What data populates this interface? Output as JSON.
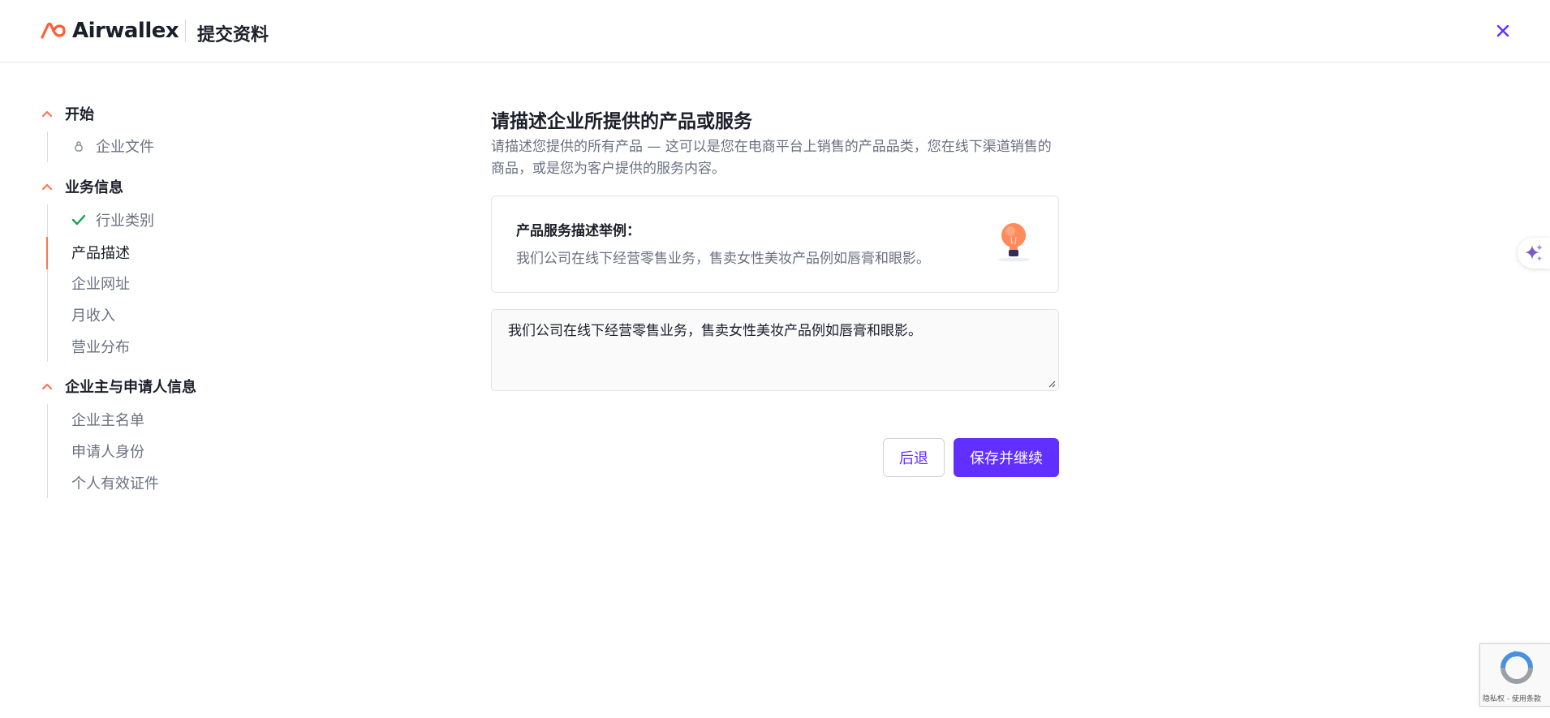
{
  "header": {
    "brand": "Airwallex",
    "title": "提交资料",
    "brand_color": "#ff5f33"
  },
  "sidebar": {
    "sections": [
      {
        "label": "开始",
        "items": [
          {
            "label": "企业文件",
            "icon": "lock-icon"
          }
        ]
      },
      {
        "label": "业务信息",
        "items": [
          {
            "label": "行业类别",
            "icon": "check-icon",
            "status": "completed"
          },
          {
            "label": "产品描述",
            "status": "active"
          },
          {
            "label": "企业网址"
          },
          {
            "label": "月收入"
          },
          {
            "label": "营业分布"
          }
        ]
      },
      {
        "label": "企业主与申请人信息",
        "items": [
          {
            "label": "企业主名单"
          },
          {
            "label": "申请人身份"
          },
          {
            "label": "个人有效证件"
          }
        ]
      }
    ]
  },
  "main": {
    "title": "请描述企业所提供的产品或服务",
    "description": "请描述您提供的所有产品 — 这可以是您在电商平台上销售的产品品类，您在线下渠道销售的商品，或是您为客户提供的服务内容。",
    "example": {
      "title": "产品服务描述举例：",
      "text": "我们公司在线下经营零售业务，售卖女性美妆产品例如唇膏和眼影。",
      "icon": "lightbulb-icon"
    },
    "input_value": "我们公司在线下经营零售业务，售卖女性美妆产品例如唇膏和眼影。",
    "back_label": "后退",
    "save_label": "保存并继续"
  },
  "recaptcha": {
    "terms": "隐私权 - 使用条款"
  },
  "colors": {
    "accent": "#612fff",
    "section_chevron": "#ff7452",
    "check": "#12a150",
    "active_bar": "#ff7452"
  }
}
